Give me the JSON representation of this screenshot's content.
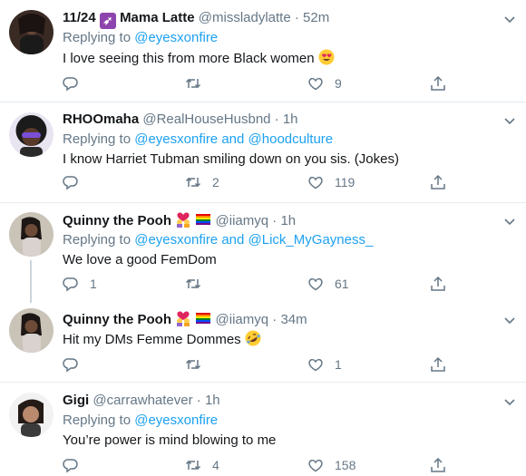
{
  "tweets": [
    {
      "date_badge": "11/24",
      "name": "Mama Latte",
      "handle": "@missladylatte",
      "sep": "·",
      "time": "52m",
      "replying_prefix": "Replying to",
      "replying_to": [
        "@eyesxonfire"
      ],
      "replying_joiner": "",
      "text": "I love seeing this from more Black women",
      "replies": "",
      "retweets": "",
      "likes": "9"
    },
    {
      "name": "RHOOmaha",
      "handle": "@RealHouseHusbnd",
      "sep": "·",
      "time": "1h",
      "replying_prefix": "Replying to",
      "replying_to": [
        "@eyesxonfire",
        "@hoodculture"
      ],
      "replying_joiner": "and",
      "text": "I know Harriet Tubman smiling down on you sis. (Jokes)",
      "replies": "",
      "retweets": "2",
      "likes": "119"
    },
    {
      "name": "Quinny the Pooh",
      "handle": "@iiamyq",
      "sep": "·",
      "time": "1h",
      "replying_prefix": "Replying to",
      "replying_to": [
        "@eyesxonfire",
        "@Lick_MyGayness_"
      ],
      "replying_joiner": "and",
      "text": "We love a good FemDom",
      "replies": "1",
      "retweets": "",
      "likes": "61"
    },
    {
      "name": "Quinny the Pooh",
      "handle": "@iiamyq",
      "sep": "·",
      "time": "34m",
      "text": "Hit my DMs Femme Dommes",
      "replies": "",
      "retweets": "",
      "likes": "1"
    },
    {
      "name": "Gigi",
      "handle": "@carrawhatever",
      "sep": "·",
      "time": "1h",
      "replying_prefix": "Replying to",
      "replying_to": [
        "@eyesxonfire"
      ],
      "replying_joiner": "",
      "text": "You’re power is mind blowing to me",
      "replies": "",
      "retweets": "4",
      "likes": "158"
    }
  ],
  "colors": {
    "accent": "#1da1f2",
    "secondary_text": "#657786",
    "divider": "#e6ecf0",
    "sagittarius": "#8e44ad"
  }
}
